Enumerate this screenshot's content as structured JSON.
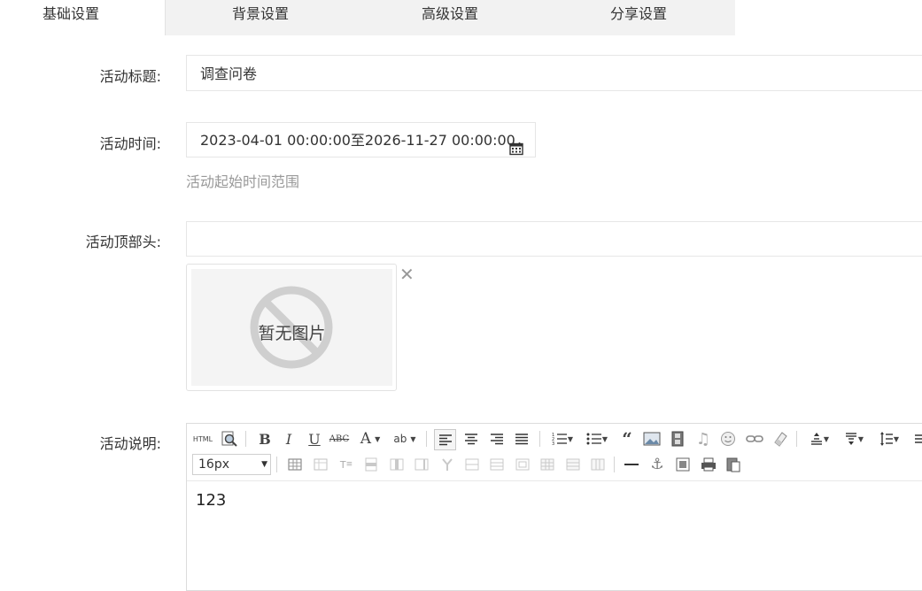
{
  "tabs": [
    {
      "label": "基础设置",
      "active": true
    },
    {
      "label": "背景设置",
      "active": false
    },
    {
      "label": "高级设置",
      "active": false
    },
    {
      "label": "分享设置",
      "active": false
    }
  ],
  "form": {
    "title_label": "活动标题:",
    "title_value": "调查问卷",
    "time_label": "活动时间:",
    "time_value": "2023-04-01 00:00:00至2026-11-27 00:00:00",
    "time_hint": "活动起始时间范围",
    "header_label": "活动顶部头:",
    "header_value": "",
    "no_image_text": "暂无图片",
    "desc_label": "活动说明:"
  },
  "editor": {
    "html_label": "HTML",
    "font_size": "16px",
    "content": "123",
    "toolbar_row1": [
      "html-source",
      "preview",
      "bold",
      "italic",
      "underline",
      "strikethrough",
      "font-color",
      "highlight-color",
      "align-left",
      "align-center",
      "align-right",
      "align-justify",
      "ordered-list",
      "unordered-list",
      "blockquote",
      "image",
      "video",
      "music",
      "emoji",
      "link",
      "eraser",
      "paragraph-spacing",
      "row-spacing",
      "line-height"
    ],
    "toolbar_row2": [
      "font-size",
      "insert-table",
      "delete-table",
      "insert-caption",
      "insert-row",
      "insert-col",
      "merge",
      "split",
      "table-props",
      "hr",
      "anchor",
      "template",
      "print",
      "paste"
    ]
  },
  "colors": {
    "tab_bg": "#f2f2f2",
    "border": "#e6e6e6",
    "hint": "#999999"
  }
}
